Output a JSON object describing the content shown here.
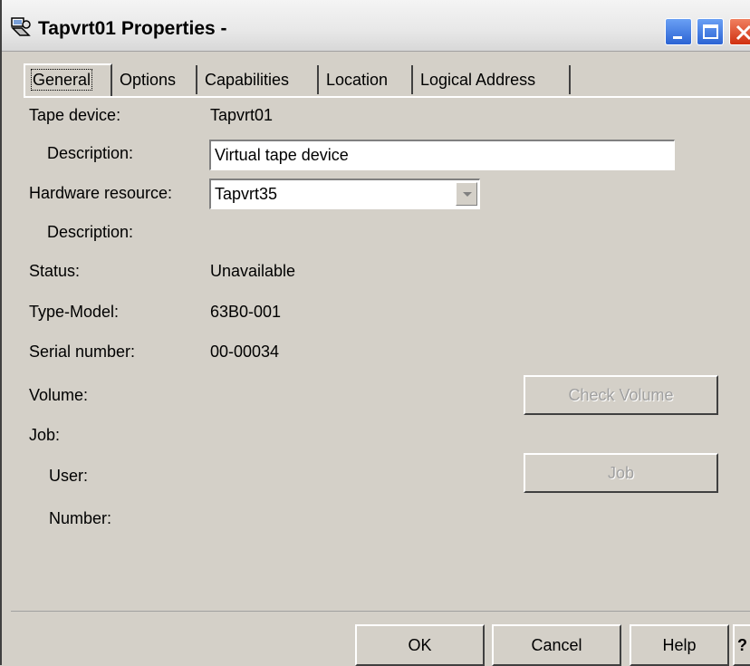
{
  "window": {
    "title": "Tapvrt01 Properties -"
  },
  "tabs": [
    {
      "label": "General"
    },
    {
      "label": "Options"
    },
    {
      "label": "Capabilities"
    },
    {
      "label": "Location"
    },
    {
      "label": "Logical Address"
    }
  ],
  "general": {
    "tape_device_label": "Tape device:",
    "tape_device_value": "Tapvrt01",
    "description_label": "Description:",
    "description_value": "Virtual tape device",
    "hardware_resource_label": "Hardware resource:",
    "hardware_resource_value": "Tapvrt35",
    "hw_description_label": "Description:",
    "status_label": "Status:",
    "status_value": "Unavailable",
    "type_model_label": "Type-Model:",
    "type_model_value": "63B0-001",
    "serial_label": "Serial number:",
    "serial_value": "00-00034",
    "volume_label": "Volume:",
    "check_volume_button": "Check Volume",
    "job_label": "Job:",
    "user_label": "User:",
    "number_label": "Number:",
    "job_button": "Job"
  },
  "footer": {
    "ok": "OK",
    "cancel": "Cancel",
    "help": "Help",
    "whats_this": "?"
  },
  "icons": {
    "title_icon": "tape-device-icon",
    "minimize": "minimize-icon",
    "maximize": "maximize-icon",
    "close": "close-icon",
    "combo_arrow": "chevron-down-icon"
  }
}
